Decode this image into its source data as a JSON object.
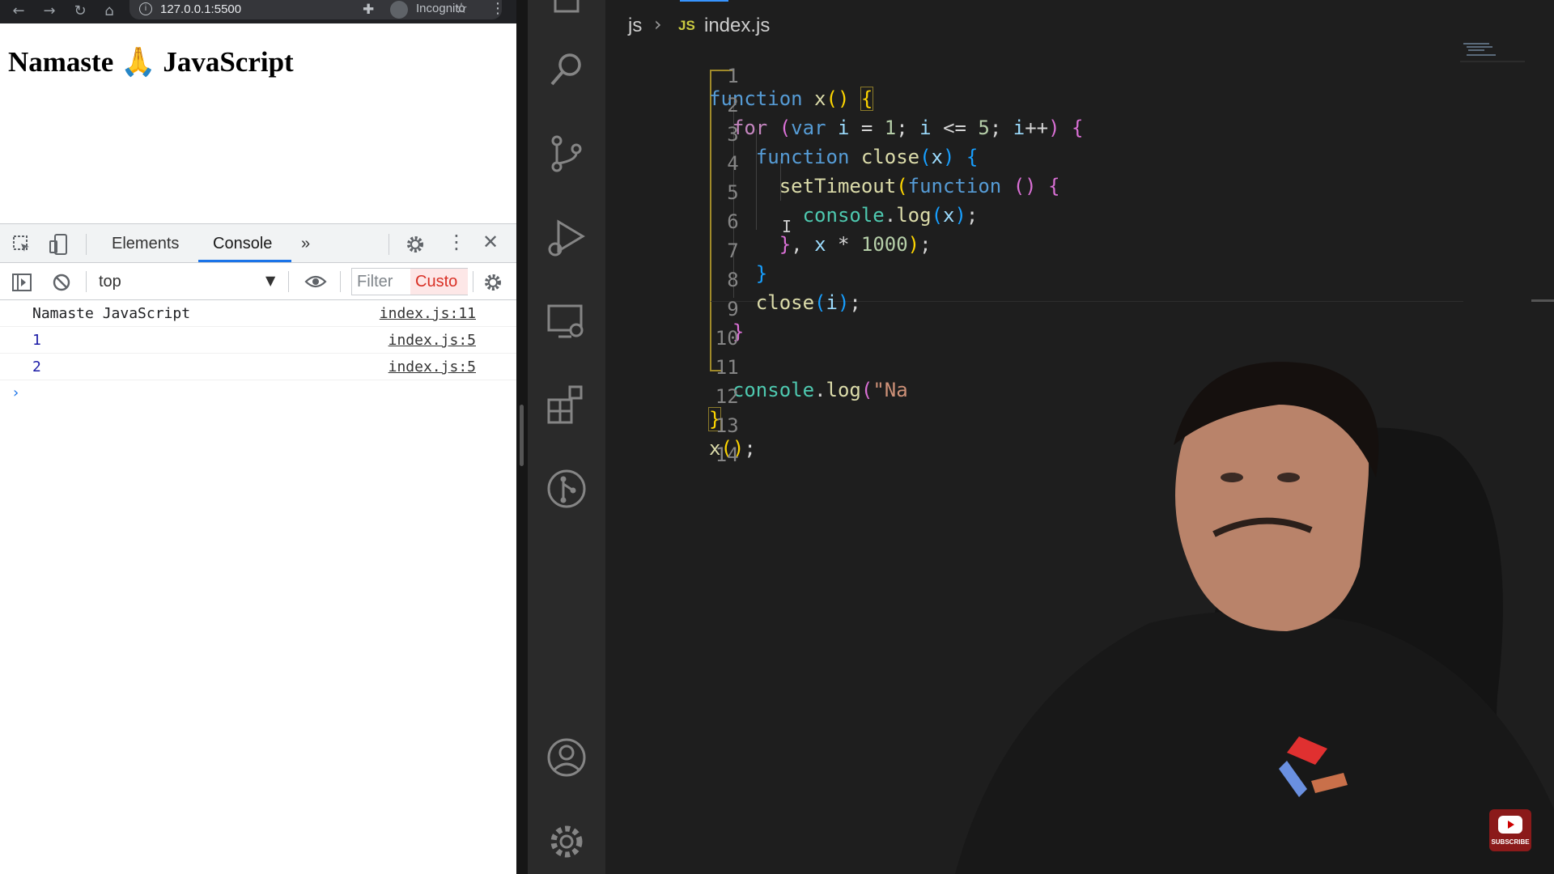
{
  "browser": {
    "url": "127.0.0.1:5500",
    "incognito_label": "Incognito",
    "page_heading": "Namaste 🙏 JavaScript"
  },
  "devtools": {
    "tabs": [
      {
        "label": "Elements",
        "active": false
      },
      {
        "label": "Console",
        "active": true
      }
    ],
    "more_tabs": "»",
    "context": "top",
    "filter_placeholder": "Filter",
    "custom_levels_label": "Custo",
    "log": [
      {
        "message": "Namaste JavaScript",
        "source": "index.js:11"
      },
      {
        "message": "1",
        "source": "index.js:5"
      },
      {
        "message": "2",
        "source": "index.js:5"
      }
    ],
    "prompt": "›"
  },
  "editor": {
    "breadcrumb": {
      "folder": "js",
      "separator": "›",
      "file_badge": "JS",
      "file": "index.js"
    },
    "line_numbers": [
      "1",
      "2",
      "3",
      "4",
      "5",
      "6",
      "7",
      "8",
      "9",
      "10",
      "11",
      "12",
      "13",
      "14"
    ],
    "code_lines": [
      "function x() {",
      "  for (var i = 1; i <= 5; i++) {",
      "    function close(x) {",
      "      setTimeout(function () {",
      "        console.log(x);",
      "      }, x * 1000);",
      "    }",
      "    close(i);",
      "  }",
      "",
      "  console.log(\"Namaste JavaScript\");",
      "}",
      "x();",
      ""
    ]
  },
  "overlay": {
    "subscribe_label": "SUBSCRIBE"
  }
}
